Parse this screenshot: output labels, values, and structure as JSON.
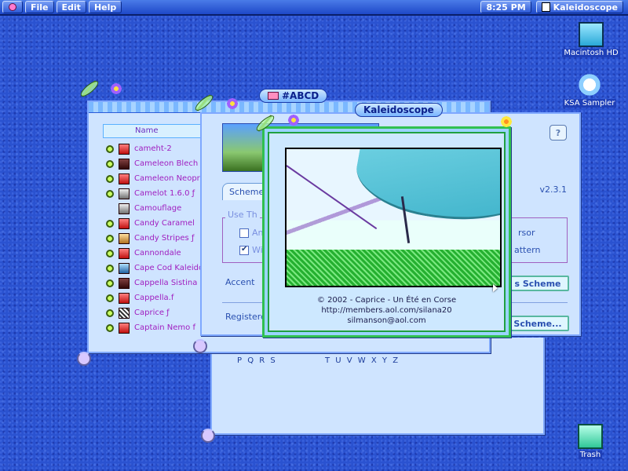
{
  "menubar": {
    "menus": [
      "File",
      "Edit",
      "Help"
    ],
    "clock": "8:25 PM",
    "active_app": "Kaleidoscope"
  },
  "desktop": {
    "icons": [
      {
        "label": "Macintosh HD",
        "icon": "hard-drive-icon"
      },
      {
        "label": "KSA Sampler",
        "icon": "ksa-sampler-icon"
      },
      {
        "label": "Trash",
        "icon": "trash-icon"
      }
    ]
  },
  "font_window": {
    "title": "#ABCD",
    "column_header": "Name",
    "items": [
      {
        "name": "cameht-2",
        "icon": "red"
      },
      {
        "name": "Cameleon Blech",
        "icon": "dark"
      },
      {
        "name": "Cameleon Neopren",
        "icon": "red"
      },
      {
        "name": "Camelot 1.6.0 ƒ",
        "icon": "grey"
      },
      {
        "name": "Camouflage",
        "icon": "grey",
        "no_bullet": true
      },
      {
        "name": "Candy Caramel",
        "icon": "red"
      },
      {
        "name": "Candy Stripes ƒ",
        "icon": "tan"
      },
      {
        "name": "Cannondale",
        "icon": "red"
      },
      {
        "name": "Cape Cod Kaleidoscope",
        "icon": "blue"
      },
      {
        "name": "Cappella Sistina",
        "icon": "dark"
      },
      {
        "name": "Cappella.f",
        "icon": "red"
      },
      {
        "name": "Caprice ƒ",
        "icon": "check"
      },
      {
        "name": "Captain Nemo f",
        "icon": "red"
      }
    ]
  },
  "settings_window": {
    "title": "Kaleidoscope",
    "version": "v2.3.1",
    "help_label": "?",
    "tab": "Scheme",
    "group_label": "Use Th",
    "option1": "An",
    "option2": "Wi",
    "option1_right": "rsor",
    "option2_right": "attern",
    "accent_label": "Accent",
    "scheme_button": "s Scheme",
    "scheme_button2": "Scheme...",
    "registered": "Registere"
  },
  "char_window": {
    "row1": "P Q R S",
    "row2": "T U V W X Y Z"
  },
  "about_window": {
    "copyright": "© 2002 - Caprice - Un Été en Corse",
    "url": "http://members.aol.com/silana20",
    "email": "silmanson@aol.com"
  },
  "colors": {
    "desktop": "#2a52d0",
    "window_bg": "#cfe4ff",
    "list_text": "#a020c0",
    "about_border": "#30c050"
  }
}
